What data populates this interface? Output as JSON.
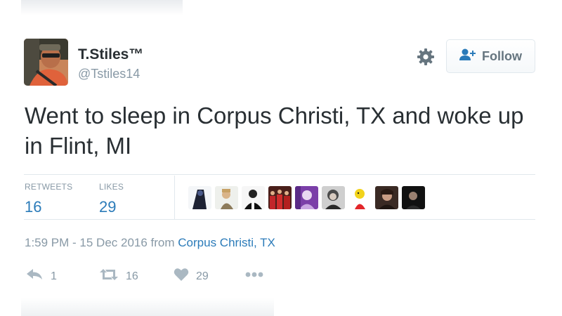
{
  "author": {
    "display_name": "T.Stiles™",
    "handle": "@Tstiles14"
  },
  "header": {
    "follow_label": "Follow"
  },
  "tweet": {
    "text": "Went to sleep in Corpus Christi, TX and woke up in Flint, MI"
  },
  "stats": {
    "retweets_label": "RETWEETS",
    "retweets": "16",
    "likes_label": "LIKES",
    "likes": "29"
  },
  "meta": {
    "timestamp": "1:59 PM - 15 Dec 2016 from",
    "location": "Corpus Christi, TX"
  },
  "actions": {
    "reply_count": "1",
    "retweet_count": "16",
    "like_count": "29"
  },
  "colors": {
    "link": "#2b7bb9",
    "muted": "#8899a6",
    "text": "#292f33"
  },
  "icons": [
    "gear-icon",
    "follow-user-icon",
    "reply-icon",
    "retweet-icon",
    "heart-icon",
    "more-icon"
  ]
}
